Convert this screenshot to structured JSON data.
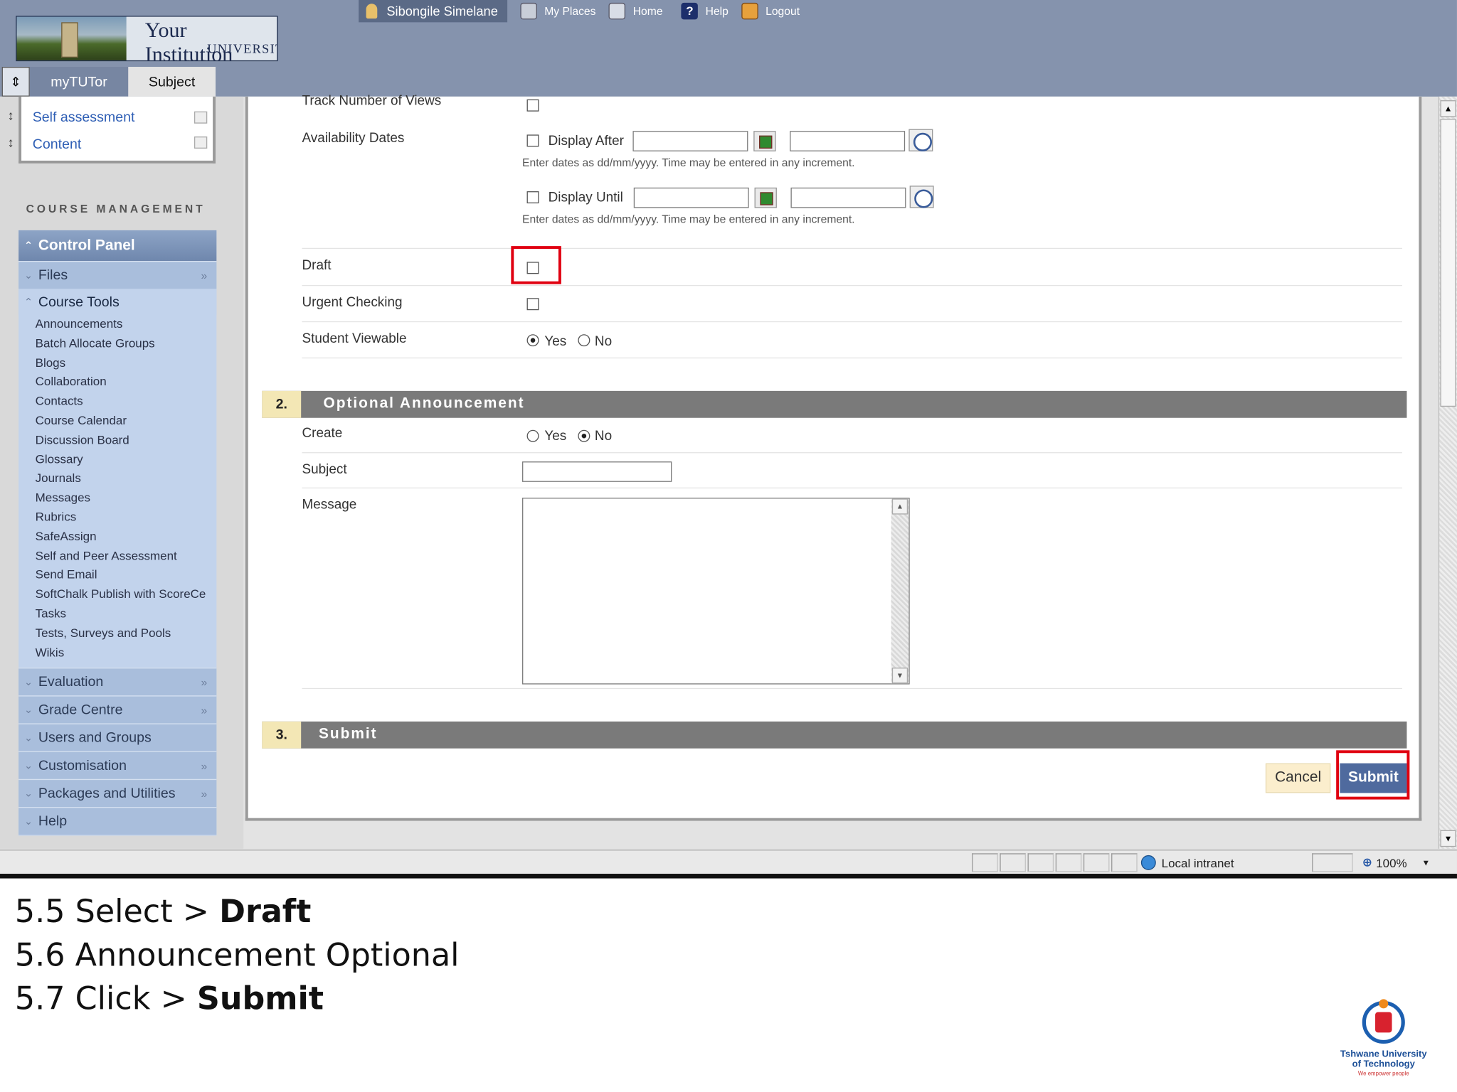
{
  "header": {
    "logo_title": "Your Institution",
    "logo_subtitle": "UNIVERSITY",
    "user_name": "Sibongile Simelane",
    "nav": [
      "My Places",
      "Home",
      "Help",
      "Logout"
    ],
    "tabs": [
      "myTUTor",
      "Subject"
    ]
  },
  "tools": [
    "Self assessment",
    "Content"
  ],
  "sidebar": {
    "title": "COURSE MANAGEMENT",
    "control_panel": "Control Panel",
    "files": "Files",
    "course_tools": "Course Tools",
    "tool_items": [
      "Announcements",
      "Batch Allocate Groups",
      "Blogs",
      "Collaboration",
      "Contacts",
      "Course Calendar",
      "Discussion Board",
      "Glossary",
      "Journals",
      "Messages",
      "Rubrics",
      "SafeAssign",
      "Self and Peer Assessment",
      "Send Email",
      "SoftChalk Publish with ScoreCe",
      "Tasks",
      "Tests, Surveys and Pools",
      "Wikis"
    ],
    "sections": [
      "Evaluation",
      "Grade Centre",
      "Users and Groups",
      "Customisation",
      "Packages and Utilities",
      "Help"
    ]
  },
  "form": {
    "track_views_label": "Track Number of Views",
    "availability_label": "Availability Dates",
    "display_after_label": "Display After",
    "display_until_label": "Display Until",
    "date_hint": "Enter dates as dd/mm/yyyy. Time may be entered in any increment.",
    "draft_label": "Draft",
    "urgent_label": "Urgent Checking",
    "student_viewable_label": "Student Viewable",
    "yes": "Yes",
    "no": "No",
    "student_viewable_value": "Yes"
  },
  "section2": {
    "number": "2.",
    "title": "Optional Announcement",
    "create_label": "Create",
    "create_value": "No",
    "subject_label": "Subject",
    "message_label": "Message"
  },
  "section3": {
    "number": "3.",
    "title": "Submit",
    "cancel": "Cancel",
    "submit": "Submit"
  },
  "statusbar": {
    "zone": "Local intranet",
    "zoom": "100%"
  },
  "slide": {
    "step1_prefix": "5.5 Select > ",
    "step1_bold": "Draft",
    "step2": "5.6  Announcement Optional",
    "step3_prefix": "5.7 Click > ",
    "step3_bold": "Submit",
    "tut_name": "Tshwane University of Technology",
    "tut_tagline": "We empower people"
  }
}
